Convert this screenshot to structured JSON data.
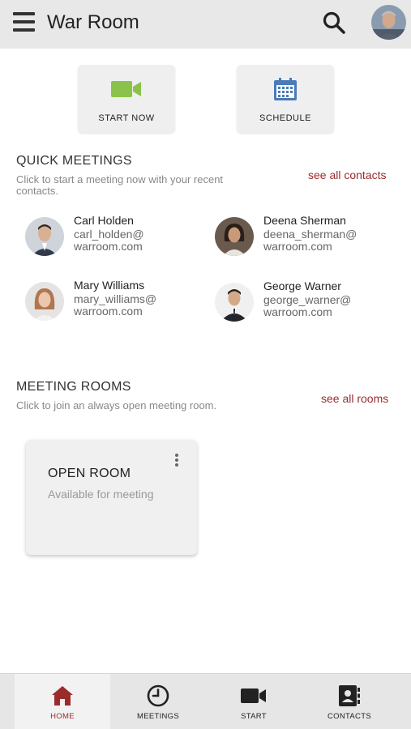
{
  "header": {
    "title": "War Room",
    "menu_icon": "hamburger-menu-icon",
    "search_icon": "search-icon",
    "avatar": "user-avatar"
  },
  "actions": [
    {
      "label": "START NOW",
      "icon": "video-camera-icon",
      "color": "#8bc34a"
    },
    {
      "label": "SCHEDULE",
      "icon": "calendar-icon",
      "color": "#4a7ab8"
    }
  ],
  "quick_meetings": {
    "title": "QUICK MEETINGS",
    "description": "Click to start a meeting now with your recent contacts.",
    "see_all": "see all contacts",
    "contacts": [
      {
        "name": "Carl Holden",
        "email": "carl_holden@ warroom.com"
      },
      {
        "name": "Deena Sherman",
        "email": "deena_sherman@ warroom.com"
      },
      {
        "name": "Mary Williams",
        "email": "mary_williams@ warroom.com"
      },
      {
        "name": "George Warner",
        "email": "george_warner@ warroom.com"
      }
    ]
  },
  "meeting_rooms": {
    "title": "MEETING ROOMS",
    "description": "Click to join an always open meeting room.",
    "see_all": "see all rooms",
    "room": {
      "name": "OPEN ROOM",
      "status": "Available for meeting"
    }
  },
  "bottom_nav": [
    {
      "label": "HOME",
      "icon": "home-icon",
      "active": true
    },
    {
      "label": "MEETINGS",
      "icon": "clock-icon",
      "active": false
    },
    {
      "label": "START",
      "icon": "video-camera-icon",
      "active": false
    },
    {
      "label": "CONTACTS",
      "icon": "contacts-book-icon",
      "active": false
    }
  ],
  "colors": {
    "accent": "#9b2c2c",
    "start_green": "#8bc34a",
    "schedule_blue": "#4a7ab8"
  }
}
